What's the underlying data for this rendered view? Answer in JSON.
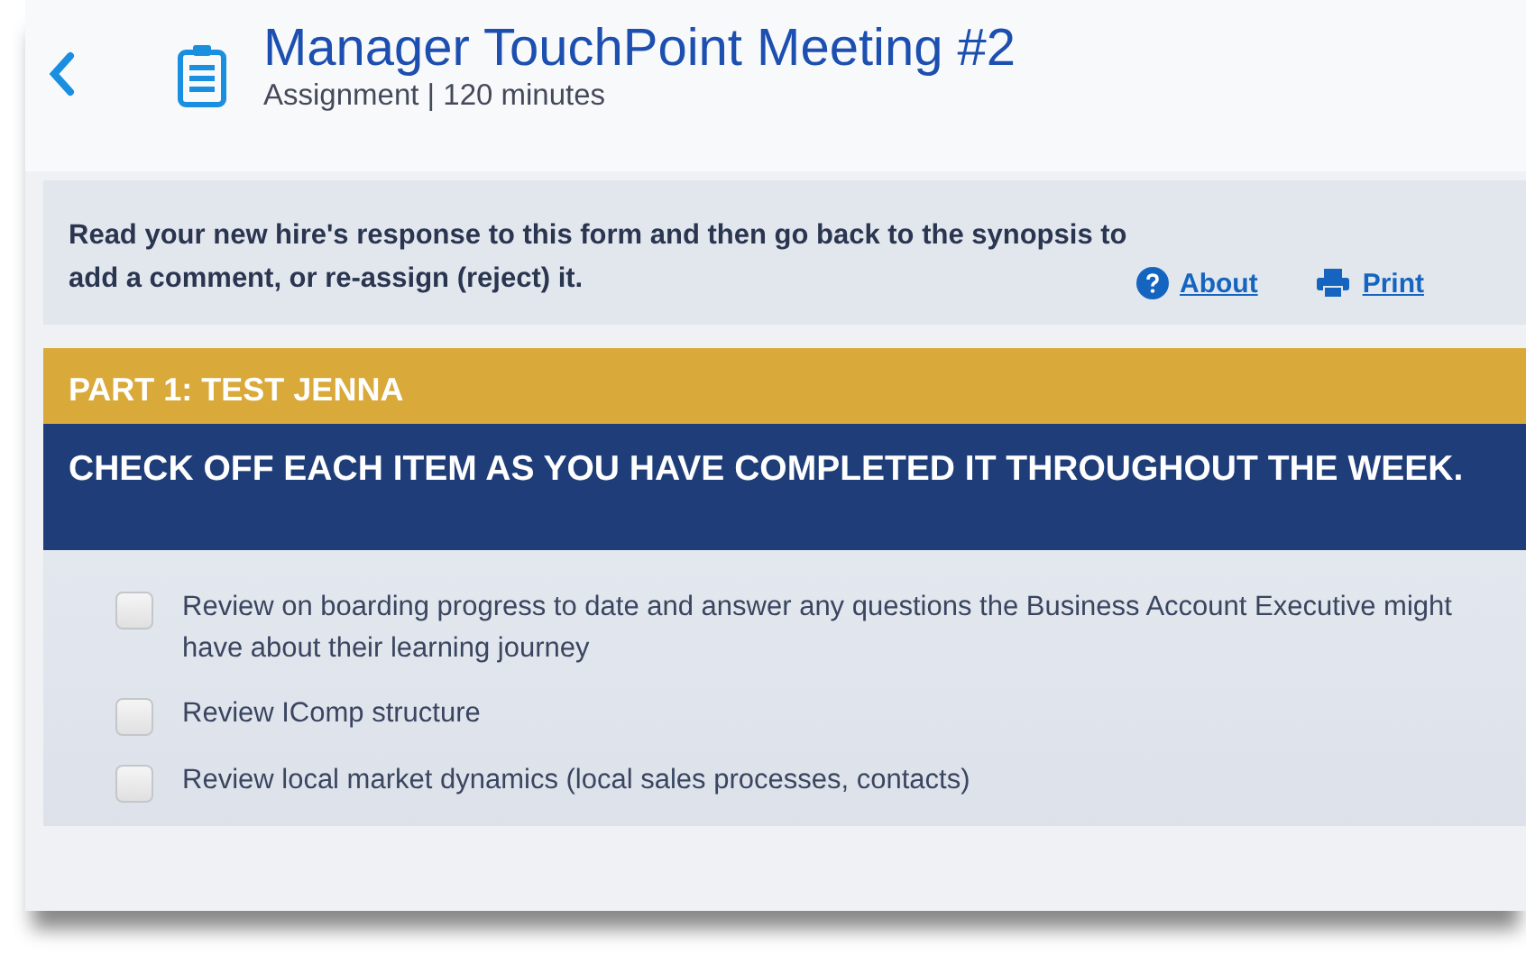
{
  "header": {
    "title": "Manager TouchPoint Meeting #2",
    "subtitle": "Assignment | 120 minutes"
  },
  "instructions": {
    "text": "Read your new hire's response to this form and then go back to the synopsis to add a comment, or re-assign (reject) it.",
    "links": [
      "About",
      "Print"
    ]
  },
  "part": {
    "title": "PART 1: TEST JENNA",
    "heading": "CHECK OFF EACH ITEM AS YOU HAVE COMPLETED IT THROUGHOUT THE WEEK."
  },
  "items": [
    {
      "label": "Review on boarding progress to date and answer any questions the Business Account Executive might have about their learning journey",
      "checked": false
    },
    {
      "label": "Review IComp structure",
      "checked": false
    },
    {
      "label": "Review local market dynamics (local sales processes, contacts)",
      "checked": false
    }
  ]
}
